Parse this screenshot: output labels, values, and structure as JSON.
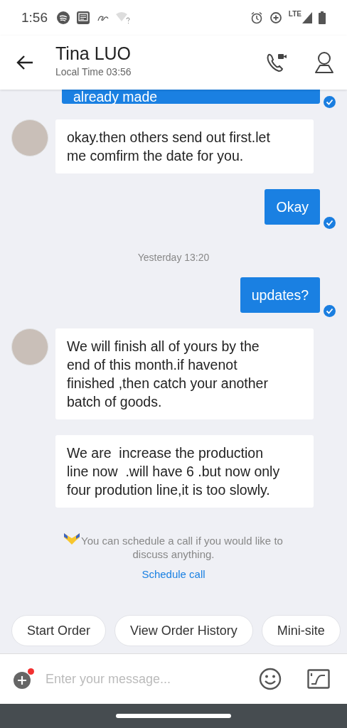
{
  "status_bar": {
    "time": "1:56",
    "network": "LTE"
  },
  "header": {
    "title": "Tina LUO",
    "subtitle": "Local Time 03:56"
  },
  "messages": [
    {
      "kind": "outgoing",
      "text": "already made",
      "read": true
    },
    {
      "kind": "incoming",
      "text": "okay.then others send out first.let me comfirm the date for you.",
      "show_avatar": true
    },
    {
      "kind": "outgoing",
      "text": "Okay",
      "read": true
    },
    {
      "kind": "timestamp",
      "text": "Yesterday 13:20"
    },
    {
      "kind": "outgoing",
      "text": "updates?",
      "read": true
    },
    {
      "kind": "incoming",
      "text": "We will finish all of yours by the end of this month.if havenot finished ,then catch your another batch of goods.",
      "show_avatar": true
    },
    {
      "kind": "incoming",
      "text": "We are  increase the production line now  .will have 6 .but now only four prodution line,it is too slowly.",
      "show_avatar": false
    }
  ],
  "notice": {
    "text": "You can schedule a call if you would like to discuss anything.",
    "link": "Schedule call"
  },
  "quick_actions": [
    "Start Order",
    "View Order History",
    "Mini-site"
  ],
  "composer": {
    "placeholder": "Enter your message...",
    "attach_badge": true
  }
}
